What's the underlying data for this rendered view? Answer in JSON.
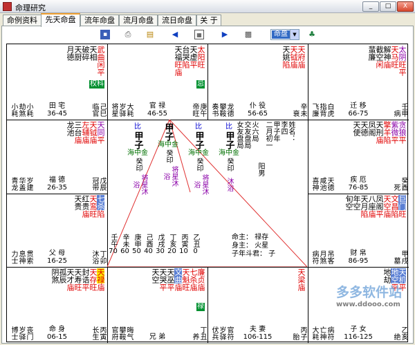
{
  "window": {
    "title": "命理研究",
    "min": "_",
    "max": "□",
    "close": "X"
  },
  "tabs": [
    "命例资料",
    "先天命盘",
    "流年命盘",
    "流月命盘",
    "流日命盘",
    "关 于"
  ],
  "active_tab": 1,
  "toolbar": {
    "mode_value": "命盘"
  },
  "palaces": [
    {
      "id": "si",
      "stars": [
        {
          "t": "武曲",
          "c": "red",
          "ann": "闲平"
        },
        {
          "t": "天相",
          "c": "plain",
          "ann": ""
        },
        {
          "t": "破碎",
          "c": "plain",
          "ann": ""
        },
        {
          "t": "天厨",
          "c": "plain",
          "ann": ""
        },
        {
          "t": "月德",
          "c": "plain",
          "ann": ""
        }
      ],
      "badge": "权科",
      "minor": [
        "小耗",
        "劫煞",
        "小耗"
      ],
      "name": "田 宅",
      "range": "36-45",
      "gz": "己巳",
      "gz2": "临官"
    },
    {
      "id": "wu",
      "stars": [
        {
          "t": "太阳",
          "c": "red",
          "ann": "旺"
        },
        {
          "t": "天虚",
          "c": "plain",
          "ann": "平"
        },
        {
          "t": "台哭",
          "c": "plain",
          "ann": "陷"
        },
        {
          "t": "天福",
          "c": "plain",
          "ann": "旺庙"
        }
      ],
      "badge": "忌",
      "minor": [
        "将星",
        "岁驿",
        "大耗"
      ],
      "name": "官 禄",
      "range": "46-55",
      "gz": "庚午",
      "gz2": "帝旺"
    },
    {
      "id": "wei",
      "stars": [
        {
          "t": "天府",
          "c": "red",
          "ann": "庙"
        },
        {
          "t": "天钺",
          "c": "red",
          "ann": "庙"
        },
        {
          "t": "天姚",
          "c": "plain",
          "ann": "陷"
        }
      ],
      "badge": "",
      "minor": [
        "奏书",
        "攀鞍",
        "龙德"
      ],
      "name": "仆 役",
      "range": "56-65",
      "gz": "辛未",
      "gz2": "衰"
    },
    {
      "id": "shen",
      "stars": [
        {
          "t": "太阴",
          "c": "purple",
          "ann": "旺平"
        },
        {
          "t": "天马",
          "c": "red",
          "ann": "旺"
        },
        {
          "t": "解神",
          "c": "plain",
          "ann": "庙"
        },
        {
          "t": "截空",
          "c": "plain",
          "ann": "闲"
        },
        {
          "t": "蜚廉",
          "c": "plain",
          "ann": ""
        }
      ],
      "badge": "",
      "minor": [
        "飞廉",
        "指背",
        "白虎"
      ],
      "name": "迁 移",
      "range": "66-75",
      "gz": "壬申",
      "gz2": "病"
    },
    {
      "id": "chen",
      "stars": [
        {
          "t": "天同",
          "c": "purple",
          "ann": "平"
        },
        {
          "t": "天钺",
          "c": "red",
          "ann": "庙"
        },
        {
          "t": "左辅",
          "c": "red",
          "ann": "庙"
        },
        {
          "t": "三台",
          "c": "plain",
          "ann": "庙"
        },
        {
          "t": "龙池",
          "c": "plain",
          "ann": ""
        }
      ],
      "badge": "",
      "minor": [
        "青龙",
        "华盖",
        "岁建"
      ],
      "name": "福 德",
      "range": "26-35",
      "gz": "戊辰",
      "gz2": "冠带"
    },
    {
      "id": "you",
      "stars": [
        {
          "t": "贪狼",
          "c": "purple",
          "ann": "平"
        },
        {
          "t": "紫微",
          "c": "purple",
          "ann": "平"
        },
        {
          "t": "擎羊",
          "c": "red",
          "ann": "陷"
        },
        {
          "t": "天刑",
          "c": "plain",
          "ann": "庙"
        },
        {
          "t": "凤阁",
          "c": "plain",
          "ann": ""
        },
        {
          "t": "天德",
          "c": "plain",
          "ann": ""
        },
        {
          "t": "天使",
          "c": "plain",
          "ann": ""
        }
      ],
      "badge": "",
      "minor": [
        "喜神",
        "咸池",
        "天德"
      ],
      "name": "疾 厄",
      "range": "76-85",
      "gz": "癸酉",
      "gz2": "死"
    },
    {
      "id": "mao",
      "stars": [
        {
          "t": "七杀",
          "c": "blueback",
          "ann": "陷"
        },
        {
          "t": "天鸾",
          "c": "red",
          "ann": "旺"
        },
        {
          "t": "红贵",
          "c": "plain",
          "ann": "庙"
        },
        {
          "t": "天贵",
          "c": "plain",
          "ann": ""
        }
      ],
      "badge": "",
      "minor": [
        "力士",
        "息神",
        "贯索"
      ],
      "name": "父 母",
      "range": "16-25",
      "gz": "丁卯",
      "gz2": "沐浴"
    },
    {
      "id": "xu",
      "stars": [
        {
          "t": "巨门",
          "c": "blueback",
          "ann": "旺"
        },
        {
          "t": "文昌",
          "c": "red",
          "ann": "陷"
        },
        {
          "t": "天空",
          "c": "red",
          "ann": "庙"
        },
        {
          "t": "凤阁",
          "c": "plain",
          "ann": "平"
        },
        {
          "t": "八座",
          "c": "plain",
          "ann": "庙"
        },
        {
          "t": "天月",
          "c": "plain",
          "ann": "陷"
        },
        {
          "t": "年空",
          "c": "plain",
          "ann": ""
        },
        {
          "t": "旬空",
          "c": "plain",
          "ann": ""
        }
      ],
      "badge": "",
      "minor": [
        "病符",
        "月煞",
        "吊客"
      ],
      "name": "财 帛",
      "range": "86-95",
      "gz": "甲戌",
      "gz2": "墓"
    },
    {
      "id": "yin",
      "stars": [
        {
          "t": "天禄",
          "c": "yellowbg",
          "ann": "庙"
        },
        {
          "t": "天存",
          "c": "red",
          "ann": "旺"
        },
        {
          "t": "封诰",
          "c": "plain",
          "ann": "平"
        },
        {
          "t": "天寿",
          "c": "plain",
          "ann": "旺"
        },
        {
          "t": "天才",
          "c": "plain",
          "ann": "庙"
        },
        {
          "t": "孤辰",
          "c": "plain",
          "ann": ""
        },
        {
          "t": "阴煞",
          "c": "plain",
          "ann": ""
        }
      ],
      "badge": "",
      "minor": [
        "博士",
        "岁驿",
        "丧门"
      ],
      "name": "命 身",
      "range": "06-15",
      "gz": "丙寅",
      "gz2": "长生"
    },
    {
      "id": "chou",
      "stars": [
        {
          "t": "廉贞",
          "c": "red",
          "ann": "庙"
        },
        {
          "t": "七杀",
          "c": "red",
          "ann": "庙"
        },
        {
          "t": "天魁",
          "c": "red",
          "ann": "旺"
        },
        {
          "t": "文曲",
          "c": "blueback",
          "ann": "庙"
        },
        {
          "t": "天巫",
          "c": "plain",
          "ann": "平"
        },
        {
          "t": "天哭",
          "c": "plain",
          "ann": "平"
        },
        {
          "t": "天空",
          "c": "plain",
          "ann": ""
        }
      ],
      "badge": "禄",
      "minor": [
        "官府",
        "攀鞍",
        "晦气"
      ],
      "name": "兄 弟",
      "range": "",
      "gz": "丁丑",
      "gz2": "养"
    },
    {
      "id": "zi",
      "stars": [
        {
          "t": "天梁",
          "c": "red",
          "ann": "庙"
        }
      ],
      "badge": "",
      "minor": [
        "伏兵",
        "岁驿",
        "官符"
      ],
      "name": "夫 妻",
      "range": "106-115",
      "gz": "丙子",
      "gz2": "胎"
    },
    {
      "id": "hai",
      "stars": [
        {
          "t": "天机",
          "c": "blueback",
          "ann": "平"
        },
        {
          "t": "地空",
          "c": "blueback",
          "ann": "平"
        },
        {
          "t": "地劫",
          "c": "plain",
          "ann": ""
        }
      ],
      "badge": "",
      "minor": [
        "大耗",
        "亡神",
        "病符"
      ],
      "name": "子 女",
      "range": "116-125",
      "gz": "乙亥",
      "gz2": "绝"
    }
  ],
  "center": {
    "pillars": [
      {
        "role": "比",
        "gz": "甲子",
        "sub1": "海中金",
        "sub2": "癸印",
        "sub3": "将星沐浴"
      },
      {
        "role": "",
        "gz": "甲子",
        "sub1": "海中金",
        "sub2": "癸印",
        "sub3": "将星沐浴"
      },
      {
        "role": "比",
        "gz": "甲子",
        "sub1": "海中金",
        "sub2": "癸印",
        "sub3": "将星沐浴"
      },
      {
        "role": "比",
        "gz": "甲子",
        "sub1": "海中金",
        "sub2": "癸印",
        "sub3": "沐浴"
      }
    ],
    "info": [
      "姓名：",
      "李四",
      "甲子年",
      "二月初一",
      "六局",
      "阳男"
    ],
    "info_left": [
      "火六局",
      "交友盘局",
      "女友盘局"
    ],
    "dayun": [
      {
        "gz": "壬午",
        "n": "70"
      },
      {
        "gz": "辛未",
        "n": "60"
      },
      {
        "gz": "庚申",
        "n": "50"
      },
      {
        "gz": "己酉",
        "n": "40"
      },
      {
        "gz": "戊戌",
        "n": "30"
      },
      {
        "gz": "丁亥",
        "n": "20"
      },
      {
        "gz": "丙寅",
        "n": "10"
      },
      {
        "gz": "乙丑",
        "n": "0"
      }
    ],
    "mingzhu": [
      "命主：  禄存",
      "身主：  火星",
      "子年斗君：  子"
    ]
  },
  "watermark": {
    "name": "多多软件站",
    "url": "www.ddooo.com"
  }
}
